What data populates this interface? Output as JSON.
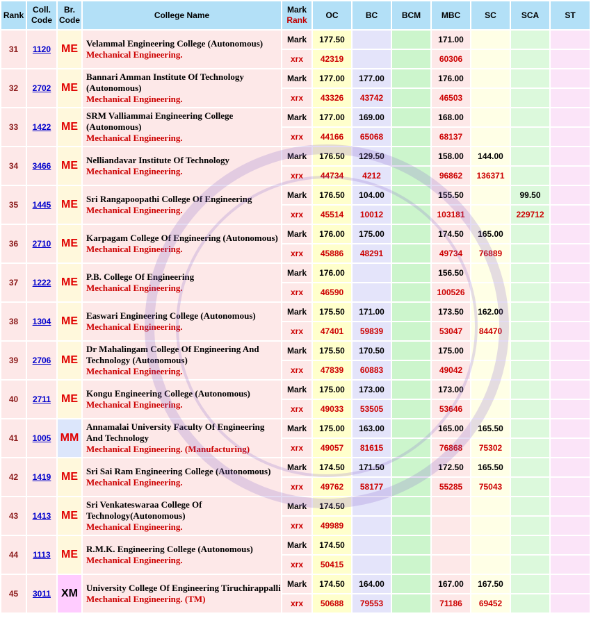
{
  "header": {
    "rank": "Rank",
    "coll_code": "Coll. Code",
    "br_code": "Br. Code",
    "college_name": "College Name",
    "mark": "Mark",
    "mark_rank": "Rank",
    "categories": [
      "OC",
      "BC",
      "BCM",
      "MBC",
      "SC",
      "SCA",
      "ST"
    ]
  },
  "labels": {
    "mark": "Mark",
    "xrx": "xrx"
  },
  "colors": {
    "header_bg": "#b3e0f7",
    "rank_text": "#8b1a1a",
    "link": "#0000cc",
    "branch_red": "#cc0000"
  },
  "rows": [
    {
      "rank": "31",
      "code": "1120",
      "br": "ME",
      "college": "Velammal Engineering College (Autonomous)",
      "branch": "Mechanical Engineering.",
      "marks": [
        "177.50",
        "",
        "",
        "171.00",
        "",
        "",
        ""
      ],
      "ranks": [
        "42319",
        "",
        "",
        "60306",
        "",
        "",
        ""
      ]
    },
    {
      "rank": "32",
      "code": "2702",
      "br": "ME",
      "college": "Bannari Amman Institute Of Technology (Autonomous)",
      "branch": "Mechanical Engineering.",
      "marks": [
        "177.00",
        "177.00",
        "",
        "176.00",
        "",
        "",
        ""
      ],
      "ranks": [
        "43326",
        "43742",
        "",
        "46503",
        "",
        "",
        ""
      ]
    },
    {
      "rank": "33",
      "code": "1422",
      "br": "ME",
      "college": "SRM Valliammai Engineering College (Autonomous)",
      "branch": "Mechanical Engineering.",
      "marks": [
        "177.00",
        "169.00",
        "",
        "168.00",
        "",
        "",
        ""
      ],
      "ranks": [
        "44166",
        "65068",
        "",
        "68137",
        "",
        "",
        ""
      ]
    },
    {
      "rank": "34",
      "code": "3466",
      "br": "ME",
      "college": "Nelliandavar Institute Of Technology",
      "branch": "Mechanical Engineering.",
      "marks": [
        "176.50",
        "129.50",
        "",
        "158.00",
        "144.00",
        "",
        ""
      ],
      "ranks": [
        "44734",
        "4212",
        "",
        "96862",
        "136371",
        "",
        ""
      ]
    },
    {
      "rank": "35",
      "code": "1445",
      "br": "ME",
      "college": "Sri Rangapoopathi College Of Engineering",
      "branch": "Mechanical Engineering.",
      "marks": [
        "176.50",
        "104.00",
        "",
        "155.50",
        "",
        "99.50",
        ""
      ],
      "ranks": [
        "45514",
        "10012",
        "",
        "103181",
        "",
        "229712",
        ""
      ]
    },
    {
      "rank": "36",
      "code": "2710",
      "br": "ME",
      "college": "Karpagam College Of Engineering (Autonomous)",
      "branch": "Mechanical Engineering.",
      "marks": [
        "176.00",
        "175.00",
        "",
        "174.50",
        "165.00",
        "",
        ""
      ],
      "ranks": [
        "45886",
        "48291",
        "",
        "49734",
        "76889",
        "",
        ""
      ]
    },
    {
      "rank": "37",
      "code": "1222",
      "br": "ME",
      "college": "P.B. College Of Engineering",
      "branch": "Mechanical Engineering.",
      "marks": [
        "176.00",
        "",
        "",
        "156.50",
        "",
        "",
        ""
      ],
      "ranks": [
        "46590",
        "",
        "",
        "100526",
        "",
        "",
        ""
      ]
    },
    {
      "rank": "38",
      "code": "1304",
      "br": "ME",
      "college": "Easwari Engineering College (Autonomous)",
      "branch": "Mechanical Engineering.",
      "marks": [
        "175.50",
        "171.00",
        "",
        "173.50",
        "162.00",
        "",
        ""
      ],
      "ranks": [
        "47401",
        "59839",
        "",
        "53047",
        "84470",
        "",
        ""
      ]
    },
    {
      "rank": "39",
      "code": "2706",
      "br": "ME",
      "college": "Dr Mahalingam College Of Engineering And Technology (Autonomous)",
      "branch": "Mechanical Engineering.",
      "marks": [
        "175.50",
        "170.50",
        "",
        "175.00",
        "",
        "",
        ""
      ],
      "ranks": [
        "47839",
        "60883",
        "",
        "49042",
        "",
        "",
        ""
      ]
    },
    {
      "rank": "40",
      "code": "2711",
      "br": "ME",
      "college": "Kongu Engineering College (Autonomous)",
      "branch": "Mechanical Engineering.",
      "marks": [
        "175.00",
        "173.00",
        "",
        "173.00",
        "",
        "",
        ""
      ],
      "ranks": [
        "49033",
        "53505",
        "",
        "53646",
        "",
        "",
        ""
      ]
    },
    {
      "rank": "41",
      "code": "1005",
      "br": "MM",
      "college": "Annamalai University Faculty Of Engineering And Technology",
      "branch": "Mechanical Engineering. (Manufacturing)",
      "marks": [
        "175.00",
        "163.00",
        "",
        "165.00",
        "165.50",
        "",
        ""
      ],
      "ranks": [
        "49057",
        "81615",
        "",
        "76868",
        "75302",
        "",
        ""
      ]
    },
    {
      "rank": "42",
      "code": "1419",
      "br": "ME",
      "college": "Sri Sai Ram Engineering College (Autonomous)",
      "branch": "Mechanical Engineering.",
      "marks": [
        "174.50",
        "171.50",
        "",
        "172.50",
        "165.50",
        "",
        ""
      ],
      "ranks": [
        "49762",
        "58177",
        "",
        "55285",
        "75043",
        "",
        ""
      ]
    },
    {
      "rank": "43",
      "code": "1413",
      "br": "ME",
      "college": "Sri Venkateswaraa College Of Technology(Autonomous)",
      "branch": "Mechanical Engineering.",
      "marks": [
        "174.50",
        "",
        "",
        "",
        "",
        "",
        ""
      ],
      "ranks": [
        "49989",
        "",
        "",
        "",
        "",
        "",
        ""
      ]
    },
    {
      "rank": "44",
      "code": "1113",
      "br": "ME",
      "college": "R.M.K. Engineering College (Autonomous)",
      "branch": "Mechanical Engineering.",
      "marks": [
        "174.50",
        "",
        "",
        "",
        "",
        "",
        ""
      ],
      "ranks": [
        "50415",
        "",
        "",
        "",
        "",
        "",
        ""
      ]
    },
    {
      "rank": "45",
      "code": "3011",
      "br": "XM",
      "college": "University College Of Engineering Tiruchirappalli",
      "branch": "Mechanical Engineering. (TM)",
      "marks": [
        "174.50",
        "164.00",
        "",
        "167.00",
        "167.50",
        "",
        ""
      ],
      "ranks": [
        "50688",
        "79553",
        "",
        "71186",
        "69452",
        "",
        ""
      ]
    }
  ]
}
